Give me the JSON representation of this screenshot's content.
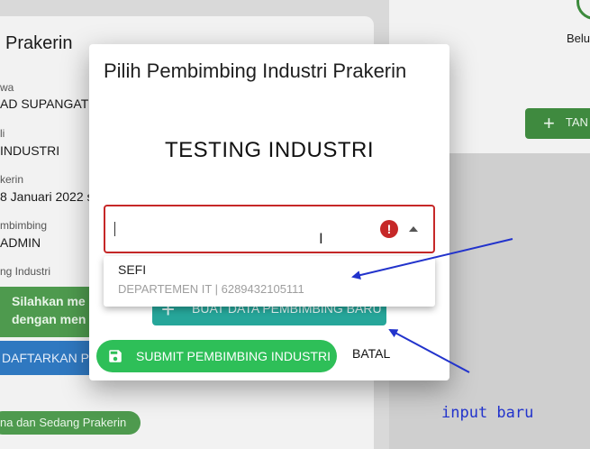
{
  "background": {
    "title": "Prakerin",
    "fields": [
      {
        "label": "wa",
        "value": "AD SUPANGAT"
      },
      {
        "label": "li",
        "value": "INDUSTRI"
      },
      {
        "label": "kerin",
        "value": "8 Januari 2022 s"
      },
      {
        "label": "mbimbing",
        "value": "ADMIN"
      },
      {
        "label": "ng Industri",
        "value": ""
      }
    ],
    "alert": {
      "line1": "Silahkan me",
      "line2": "dengan men"
    },
    "daftar_button": "DAFTARKAN PE",
    "status_chip": "na dan Sedang Prakerin",
    "right_status": "Belu",
    "tambah_button": "TAN"
  },
  "dialog": {
    "title": "Pilih Pembimbing Industri Prakerin",
    "company": "TESTING INDUSTRI",
    "select": {
      "value": "",
      "error_icon": "!"
    },
    "menu": [
      {
        "name": "SEFI",
        "detail": "DEPARTEMEN IT | 6289432105111"
      }
    ],
    "buat_button": "BUAT DATA PEMBIMBING BARU",
    "submit_button": "SUBMIT PEMBIMBING INDUSTRI",
    "batal_button": "BATAL"
  },
  "annotation": {
    "text": "input baru",
    "color": "#2233cc"
  },
  "colors": {
    "error": "#c62828",
    "submit": "#2ebf58",
    "buat": "#26a69a"
  }
}
